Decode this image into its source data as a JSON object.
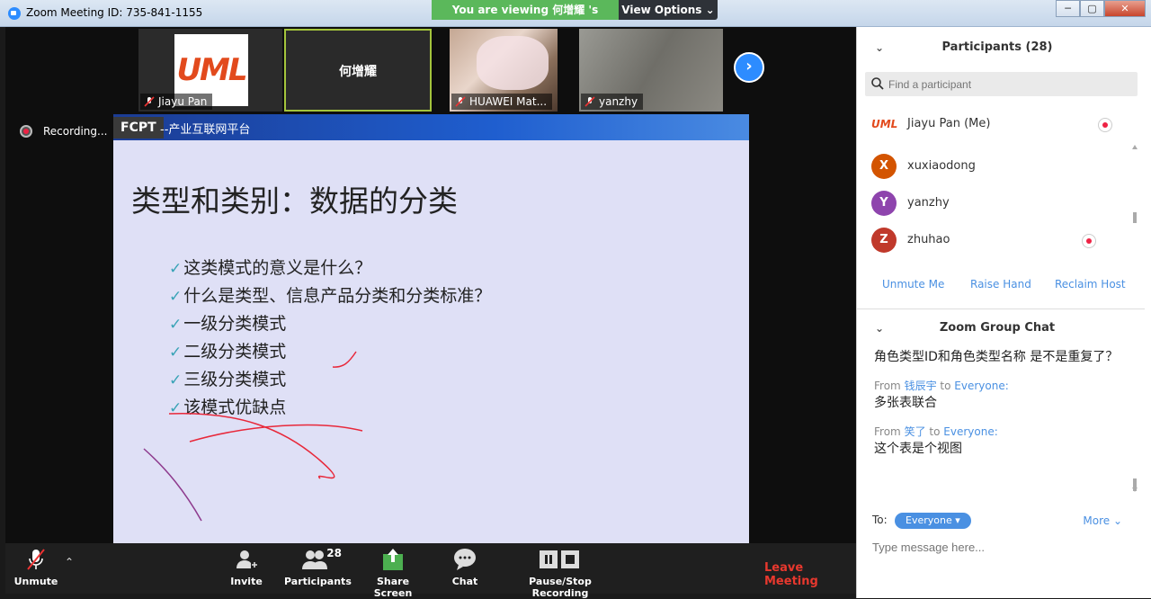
{
  "window": {
    "title": "Zoom Meeting ID: 735-841-1155"
  },
  "share_banner": {
    "text": "You are viewing 何增耀 's screen",
    "view_options": "View Options"
  },
  "thumbnails": [
    {
      "name": "Jiayu Pan"
    },
    {
      "name": "何增耀"
    },
    {
      "name": "HUAWEI Mat..."
    },
    {
      "name": "yanzhy"
    }
  ],
  "uml_logo_text": "UML",
  "recording_label": "Recording...",
  "slide": {
    "logo": "FCPT",
    "header_text": "--产业互联网平台",
    "title": "类型和类别：数据的分类",
    "bullets": [
      "这类模式的意义是什么？",
      "什么是类型、信息产品分类和分类标准？",
      "一级分类模式",
      "二级分类模式",
      "三级分类模式",
      "该模式优缺点"
    ],
    "check_glyph": "✓"
  },
  "toolbar": {
    "unmute": "Unmute",
    "invite": "Invite",
    "participants": "Participants",
    "participants_count": "28",
    "share": "Share Screen",
    "chat": "Chat",
    "record": "Pause/Stop Recording",
    "leave": "Leave Meeting"
  },
  "participants_panel": {
    "title": "Participants (28)",
    "search_placeholder": "Find a participant",
    "list": [
      {
        "name": "Jiayu Pan (Me)",
        "avatar": "UML",
        "recording": true
      },
      {
        "name": "xuxiaodong",
        "avatar": "X",
        "recording": false
      },
      {
        "name": "yanzhy",
        "avatar": "Y",
        "recording": false
      },
      {
        "name": "zhuhao",
        "avatar": "Z",
        "recording": true
      }
    ],
    "actions": {
      "unmute": "Unmute Me",
      "raise_hand": "Raise Hand",
      "reclaim_host": "Reclaim Host"
    }
  },
  "chat_panel": {
    "title": "Zoom Group Chat",
    "messages": [
      {
        "text": "角色类型ID和角色类型名称 是不是重复了？"
      },
      {
        "from_label": "From",
        "sender": "钱辰宇",
        "to_label": "to",
        "recipient": "Everyone:",
        "text": "多张表联合"
      },
      {
        "from_label": "From",
        "sender": "笑了",
        "to_label": "to",
        "recipient": "Everyone:",
        "text": "这个表是个视图"
      }
    ],
    "to_label": "To:",
    "to_value": "Everyone",
    "more": "More",
    "input_placeholder": "Type message here..."
  },
  "colors": {
    "accent": "#4a90e2",
    "share_green": "#5bb85b",
    "leave_red": "#e8382e",
    "annotation_red": "#e8283a",
    "annotation_purple": "#8e3b8e"
  }
}
